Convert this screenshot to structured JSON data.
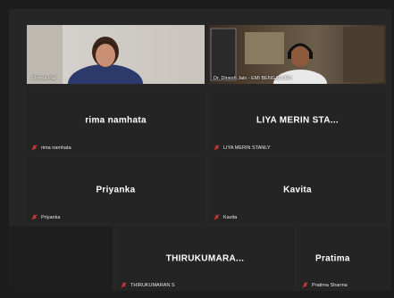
{
  "tiles": [
    {
      "id": "shreya",
      "display_name": "",
      "label": "Shreya Pal",
      "video": true
    },
    {
      "id": "dinesh",
      "display_name": "",
      "label": "Dr. Dinesh Jain - EMI BENGALURU",
      "video": true
    },
    {
      "id": "rima",
      "display_name": "rima namhata",
      "label": "rima namhata",
      "video": false
    },
    {
      "id": "liya",
      "display_name": "LIYA MERIN STA...",
      "label": "LIYA MERIN STANLY",
      "video": false
    },
    {
      "id": "priyanka",
      "display_name": "Priyanka",
      "label": "Priyanka",
      "video": false
    },
    {
      "id": "kavita",
      "display_name": "Kavita",
      "label": "Kavita",
      "video": false
    },
    {
      "id": "thiru",
      "display_name": "THIRUKUMARA...",
      "label": "THIRUKUMARAN S",
      "video": false
    },
    {
      "id": "pratima",
      "display_name": "Pratima",
      "label": "Pratima Sharma",
      "video": false
    }
  ],
  "icons": {
    "muted_mic": "mic-muted-icon"
  },
  "colors": {
    "muted": "#e53935",
    "tile_bg": "#242424",
    "page_bg": "#1c1c1c"
  }
}
